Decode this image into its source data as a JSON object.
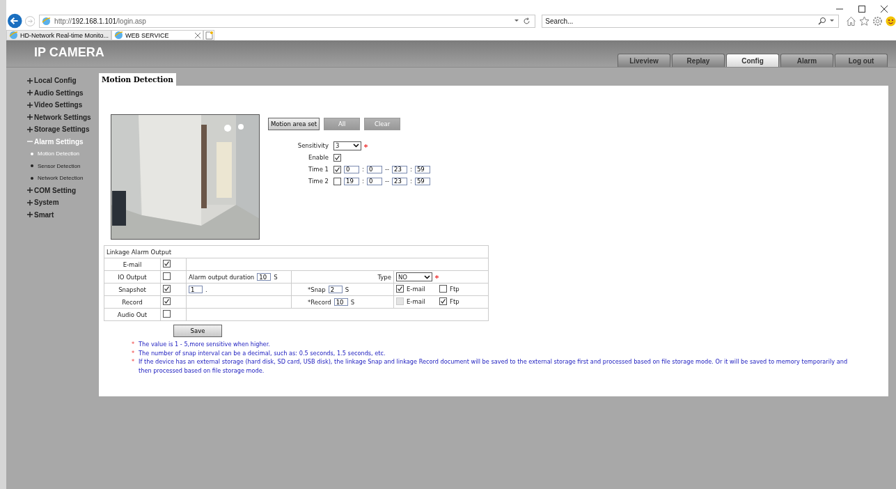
{
  "browser": {
    "url": "http://**192.168.1.101**/login.asp",
    "search": {
      "placeholder": "Search..."
    },
    "tabs": [
      {
        "title": "HD-Network Real-time Monito...",
        "selected": false
      },
      {
        "title": "WEB SERVICE",
        "selected": true
      }
    ]
  },
  "header": {
    "title": "IP CAMERA",
    "nav": [
      {
        "label": "Liveview",
        "selected": false
      },
      {
        "label": "Replay",
        "selected": false
      },
      {
        "label": "Config",
        "selected": true
      },
      {
        "label": "Alarm",
        "selected": false
      },
      {
        "label": "Log out",
        "selected": false
      }
    ]
  },
  "sidebar": {
    "items": [
      {
        "label": "Local Config",
        "expanded": false
      },
      {
        "label": "Audio Settings",
        "expanded": false
      },
      {
        "label": "Video Settings",
        "expanded": false
      },
      {
        "label": "Network Settings",
        "expanded": false
      },
      {
        "label": "Storage Settings",
        "expanded": false
      },
      {
        "label": "Alarm Settings",
        "expanded": true,
        "children": [
          {
            "label": "Motion Detection",
            "selected": true
          },
          {
            "label": "Sensor Detection",
            "selected": false
          },
          {
            "label": "Network Detection",
            "selected": false
          }
        ]
      },
      {
        "label": "COM Setting",
        "expanded": false
      },
      {
        "label": "System",
        "expanded": false
      },
      {
        "label": "Smart",
        "expanded": false
      }
    ]
  },
  "page_tab": "Motion Detection",
  "area_buttons": [
    {
      "label": "Motion area set",
      "disabled": false
    },
    {
      "label": "All",
      "disabled": true
    },
    {
      "label": "Clear",
      "disabled": true
    }
  ],
  "sensitivity": {
    "label": "Sensitivity",
    "value": "3",
    "required": true
  },
  "enable": {
    "label": "Enable",
    "checked": true
  },
  "times": [
    {
      "label": "Time 1",
      "checked": true,
      "start_hour": "0",
      "colon_1": ":",
      "start_minute": "0",
      "dash": "--",
      "end_hour": "23",
      "colon_2": ":",
      "end_minute": "59"
    },
    {
      "label": "Time 2",
      "checked": false,
      "start_hour": "19",
      "colon_1": ":",
      "start_minute": "0",
      "dash": "--",
      "end_hour": "23",
      "colon_2": ":",
      "end_minute": "59"
    }
  ],
  "linkage": {
    "title": "Linkage Alarm Output",
    "rows": [
      {
        "kind": "simple",
        "label": "E-mail",
        "checked": true
      },
      {
        "kind": "io",
        "label": "IO Output",
        "checked": false,
        "duration_label": "Alarm output duration",
        "duration": "10",
        "unit": "S",
        "type_label": "Type",
        "type": "NO",
        "type_required": true
      },
      {
        "kind": "capture",
        "label": "Snapshot",
        "checked": true,
        "interval": "1",
        "interval_suffix": ".",
        "field_label": "*Snap",
        "value": "2",
        "unit": "S",
        "targets": [
          {
            "label": "E-mail",
            "checked": true,
            "disabled": false
          },
          {
            "label": "Ftp",
            "checked": false,
            "disabled": false
          }
        ]
      },
      {
        "kind": "capture",
        "label": "Record",
        "checked": true,
        "field_label": "*Record",
        "value": "10",
        "unit": "S",
        "targets": [
          {
            "label": "E-mail",
            "checked": false,
            "disabled": true
          },
          {
            "label": "Ftp",
            "checked": true,
            "disabled": false
          }
        ]
      },
      {
        "kind": "simple",
        "label": "Audio Out",
        "checked": false
      }
    ]
  },
  "save_button": "Save",
  "notes": [
    {
      "mark": "*",
      "text": "The value is 1 - 5,more sensitive when higher."
    },
    {
      "mark": "*",
      "text": "The number of snap interval can be a decimal, such as: 0.5 seconds, 1.5 seconds, etc."
    },
    {
      "mark": "*",
      "text": "If the device has an external storage (hard disk, SD card, USB disk), the linkage Snap and linkage Record document will be saved to the external storage first and processed based on file storage mode. Or it will be saved to memory temporarily and then processed based on file storage mode."
    }
  ]
}
